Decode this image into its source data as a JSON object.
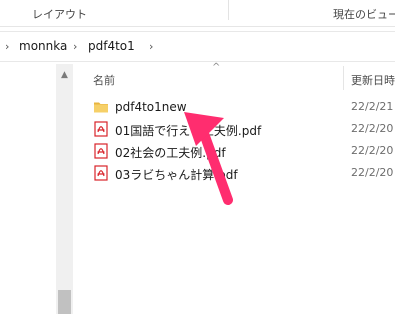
{
  "ribbon": {
    "layout_label": "レイアウト",
    "current_view_label": "現在のビュー"
  },
  "address": {
    "chevron": "›",
    "crumbs": [
      "monnka",
      "pdf4to1"
    ]
  },
  "navpane": {
    "scroll_up": "▲"
  },
  "columns": {
    "name": "名前",
    "date": "更新日時",
    "sort_indicator": "^"
  },
  "files": [
    {
      "name": "pdf4to1new",
      "date": "22/2/21",
      "type": "folder"
    },
    {
      "name": "01国語で行える工夫例.pdf",
      "date": "22/2/20",
      "type": "pdf"
    },
    {
      "name": "02社会の工夫例.pdf",
      "date": "22/2/20",
      "type": "pdf"
    },
    {
      "name": "03ラビちゃん計算.pdf",
      "date": "22/2/20",
      "type": "pdf"
    }
  ],
  "colors": {
    "annotation_arrow": "#ff2d6f",
    "folder": "#f3c74f",
    "pdf": "#d8232a"
  }
}
